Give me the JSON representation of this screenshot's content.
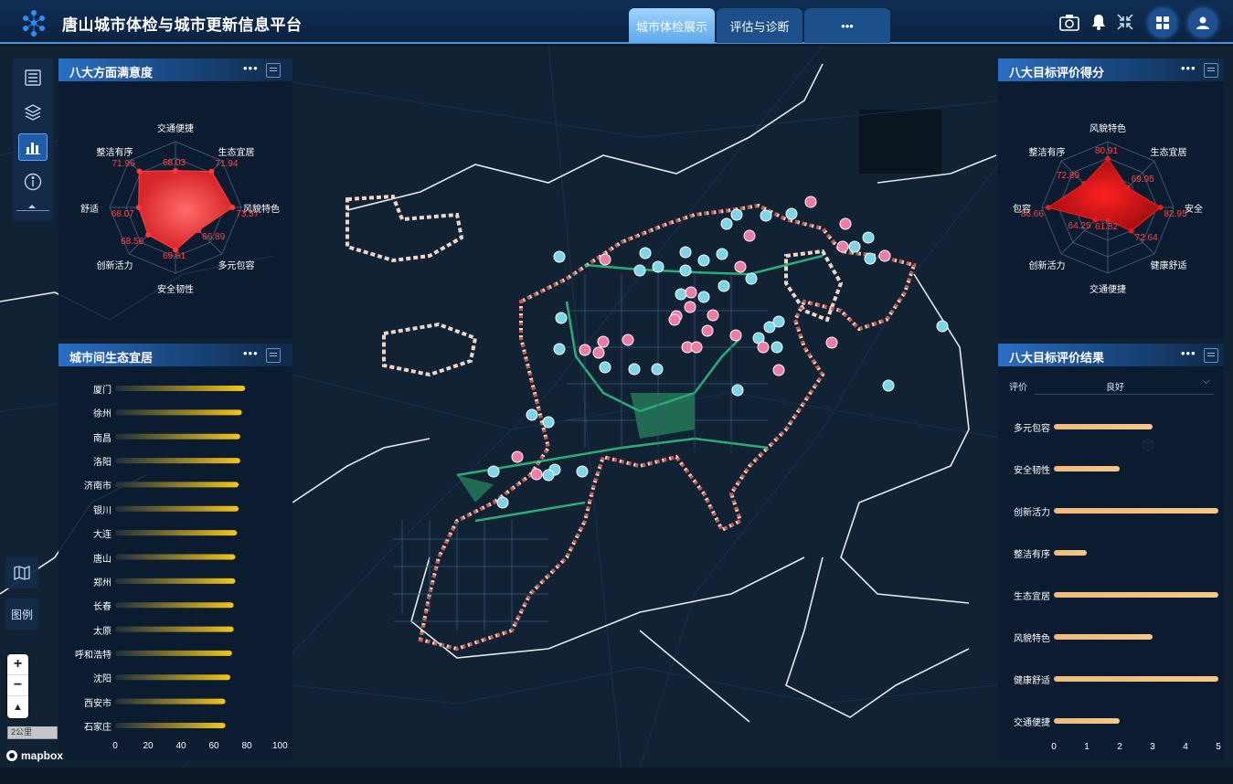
{
  "header": {
    "title": "唐山城市体检与城市更新信息平台",
    "tabs": [
      "城市体检展示",
      "评估与诊断",
      "•••"
    ]
  },
  "map": {
    "legend_label": "图例",
    "scale_label": "2公里",
    "attribution": "mapbox"
  },
  "satisfaction_panel": {
    "title": "八大方面满意度",
    "more": "•••",
    "chart_data": {
      "type": "radar",
      "title": "八大方面满意度",
      "categories": [
        "交通便捷",
        "生态宜居",
        "风貌特色",
        "多元包容",
        "安全韧性",
        "创新活力",
        "舒适",
        "整洁有序"
      ],
      "values": [
        68.03,
        71.94,
        73.57,
        66.89,
        69.61,
        68.56,
        68.07,
        71.96
      ],
      "labels": [
        "68.03",
        "71.94",
        "73.57",
        "66.89",
        "69.61",
        "68.56",
        "68.07",
        "71.96"
      ],
      "color": "#ff3b3b"
    }
  },
  "ecology_panel": {
    "title": "城市间生态宜居",
    "more": "•••",
    "chart_data": {
      "type": "bar",
      "orientation": "horizontal",
      "title": "城市间生态宜居",
      "categories": [
        "厦门",
        "徐州",
        "南昌",
        "洛阳",
        "济南市",
        "银川",
        "大连",
        "唐山",
        "郑州",
        "长春",
        "太原",
        "呼和浩特",
        "沈阳",
        "西安市",
        "石家庄"
      ],
      "values": [
        79,
        77,
        76,
        76,
        75,
        75,
        74,
        73,
        73,
        72,
        72,
        71,
        70,
        67,
        67
      ],
      "xlim": [
        0,
        100
      ],
      "xticks": [
        "0",
        "20",
        "40",
        "60",
        "80",
        "100"
      ],
      "color": "#f2c21b"
    }
  },
  "target_score_panel": {
    "title": "八大目标评价得分",
    "more": "•••",
    "chart_data": {
      "type": "radar",
      "title": "八大目标评价得分",
      "categories": [
        "风貌特色",
        "生态宜居",
        "安全",
        "健康舒适",
        "交通便捷",
        "创新活力",
        "包容",
        "整洁有序"
      ],
      "values": [
        80.91,
        69.95,
        82.95,
        72.64,
        61.82,
        64.25,
        86.66,
        72.89
      ],
      "labels": [
        "80.91",
        "69.95",
        "82.95",
        "72.64",
        "61.82",
        "64.25",
        "86.66",
        "72.89"
      ],
      "color": "#e81c1c"
    }
  },
  "target_result_panel": {
    "title": "八大目标评价结果",
    "more": "•••",
    "filter_label": "评价",
    "filter_value": "良好",
    "chart_data": {
      "type": "bar",
      "orientation": "horizontal",
      "title": "八大目标评价结果",
      "categories": [
        "多元包容",
        "安全韧性",
        "创新活力",
        "整洁有序",
        "生态宜居",
        "风貌特色",
        "健康舒适",
        "交通便捷"
      ],
      "values": [
        3,
        2,
        5,
        1,
        5,
        3,
        5,
        2
      ],
      "xlim": [
        0,
        5
      ],
      "xticks": [
        "0",
        "1",
        "2",
        "3",
        "4",
        "5"
      ],
      "color": "#f3c27c"
    }
  }
}
